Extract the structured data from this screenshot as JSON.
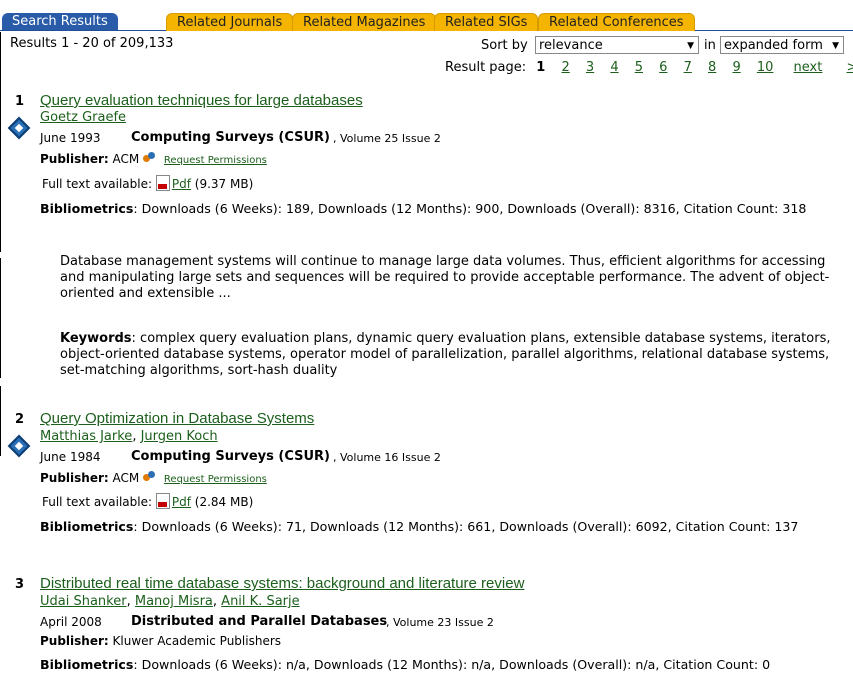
{
  "tabs": [
    "Search Results",
    "Related Journals",
    "Related Magazines",
    "Related SIGs",
    "Related Conferences"
  ],
  "results_count": "Results 1 - 20 of 209,133",
  "sort": {
    "label": "Sort by",
    "value": "relevance",
    "in_label": "in",
    "form_value": "expanded form"
  },
  "pager": {
    "label": "Result page:",
    "current": "1",
    "pages": [
      "2",
      "3",
      "4",
      "5",
      "6",
      "7",
      "8",
      "9",
      "10"
    ],
    "next": "next",
    "last": ">>"
  },
  "results": [
    {
      "num": "1",
      "title": "Query evaluation techniques for large databases",
      "authors": [
        "Goetz Graefe"
      ],
      "date": "June 1993",
      "venue": "Computing Surveys (CSUR)",
      "volume": ", Volume 25 Issue 2",
      "publisher_label": "Publisher:",
      "publisher": "ACM",
      "permissions": "Request Permissions",
      "fulltext_label": "Full text available:",
      "pdf_label": "Pdf",
      "pdf_size": "(9.37 MB)",
      "biblio_label": "Bibliometrics",
      "biblio": ":  Downloads (6 Weeks): 189,   Downloads (12 Months): 900,   Downloads (Overall): 8316,   Citation Count: 318",
      "abstract": "Database management systems will continue to manage large data volumes. Thus, efficient algorithms for accessing and manipulating large sets and sequences will be required to provide acceptable performance. The advent of object-oriented and extensible ...",
      "keywords_label": "Keywords",
      "keywords": ": complex query evaluation plans, dynamic query evaluation plans, extensible database systems, iterators, object-oriented database systems, operator model of parallelization, parallel algorithms, relational database systems, set-matching algorithms, sort-hash duality"
    },
    {
      "num": "2",
      "title": "Query Optimization in Database Systems",
      "authors": [
        "Matthias Jarke",
        "Jurgen Koch"
      ],
      "date": "June 1984",
      "venue": "Computing Surveys (CSUR)",
      "volume": ", Volume 16 Issue 2",
      "publisher_label": "Publisher:",
      "publisher": "ACM",
      "permissions": "Request Permissions",
      "fulltext_label": "Full text available:",
      "pdf_label": "Pdf",
      "pdf_size": "(2.84 MB)",
      "biblio_label": "Bibliometrics",
      "biblio": ":  Downloads (6 Weeks): 71,   Downloads (12 Months): 661,   Downloads (Overall): 6092,   Citation Count: 137"
    },
    {
      "num": "3",
      "title": "Distributed real time database systems: background and literature review",
      "authors": [
        "Udai Shanker",
        "Manoj Misra",
        "Anil K. Sarje"
      ],
      "date": "April 2008",
      "venue": "Distributed and Parallel Databases",
      "volume": ", Volume 23 Issue 2",
      "publisher_label": "Publisher:",
      "publisher": "Kluwer Academic Publishers",
      "biblio_label": "Bibliometrics",
      "biblio": ":  Downloads (6 Weeks): n/a,   Downloads (12 Months): n/a,   Downloads (Overall): n/a,   Citation Count: 0"
    }
  ]
}
